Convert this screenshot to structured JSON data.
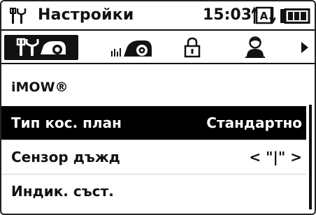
{
  "status_bar": {
    "title": "Настройки",
    "time": "15:03",
    "auto_icon": "auto-mode-icon",
    "battery_icon": "battery-icon"
  },
  "tabs": [
    {
      "icon": "settings-tools-icon",
      "active": true
    },
    {
      "icon": "mower-icon",
      "active": false
    },
    {
      "icon": "lock-icon",
      "active": false
    },
    {
      "icon": "user-icon",
      "active": false
    }
  ],
  "tabs_more_icon": "arrow-right-icon",
  "menu": {
    "section_title": "iMOW®",
    "rows": [
      {
        "label": "Тип кос. план",
        "value": "Стандартно",
        "selected": true
      },
      {
        "label": "Сензор дъжд",
        "value": "< \"|\" >",
        "selected": false
      },
      {
        "label": "Индик. съст.",
        "value": "",
        "selected": false
      }
    ]
  },
  "colors": {
    "background": "#ffffff",
    "foreground": "#111111",
    "selection": "#000000"
  }
}
